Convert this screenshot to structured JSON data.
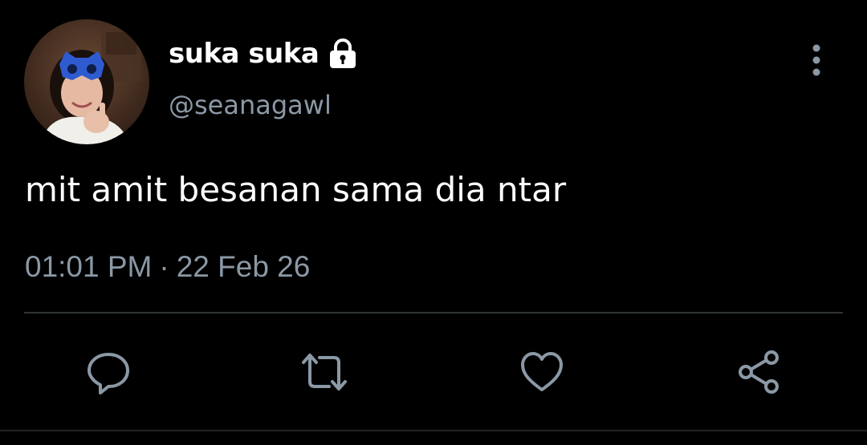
{
  "tweet": {
    "display_name": "suka suka",
    "handle": "@seanagawl",
    "text": "mit amit besanan sama dia ntar",
    "time": "01:01 PM",
    "separator": "·",
    "date": "22 Feb 26"
  },
  "icons": {
    "lock": "lock-icon",
    "more": "more-vertical-icon",
    "reply": "reply-icon",
    "retweet": "retweet-icon",
    "like": "heart-icon",
    "share": "share-icon"
  },
  "colors": {
    "background": "#000000",
    "primary_text": "#ffffff",
    "secondary_text": "#8b98a5",
    "divider": "#2f3336"
  }
}
